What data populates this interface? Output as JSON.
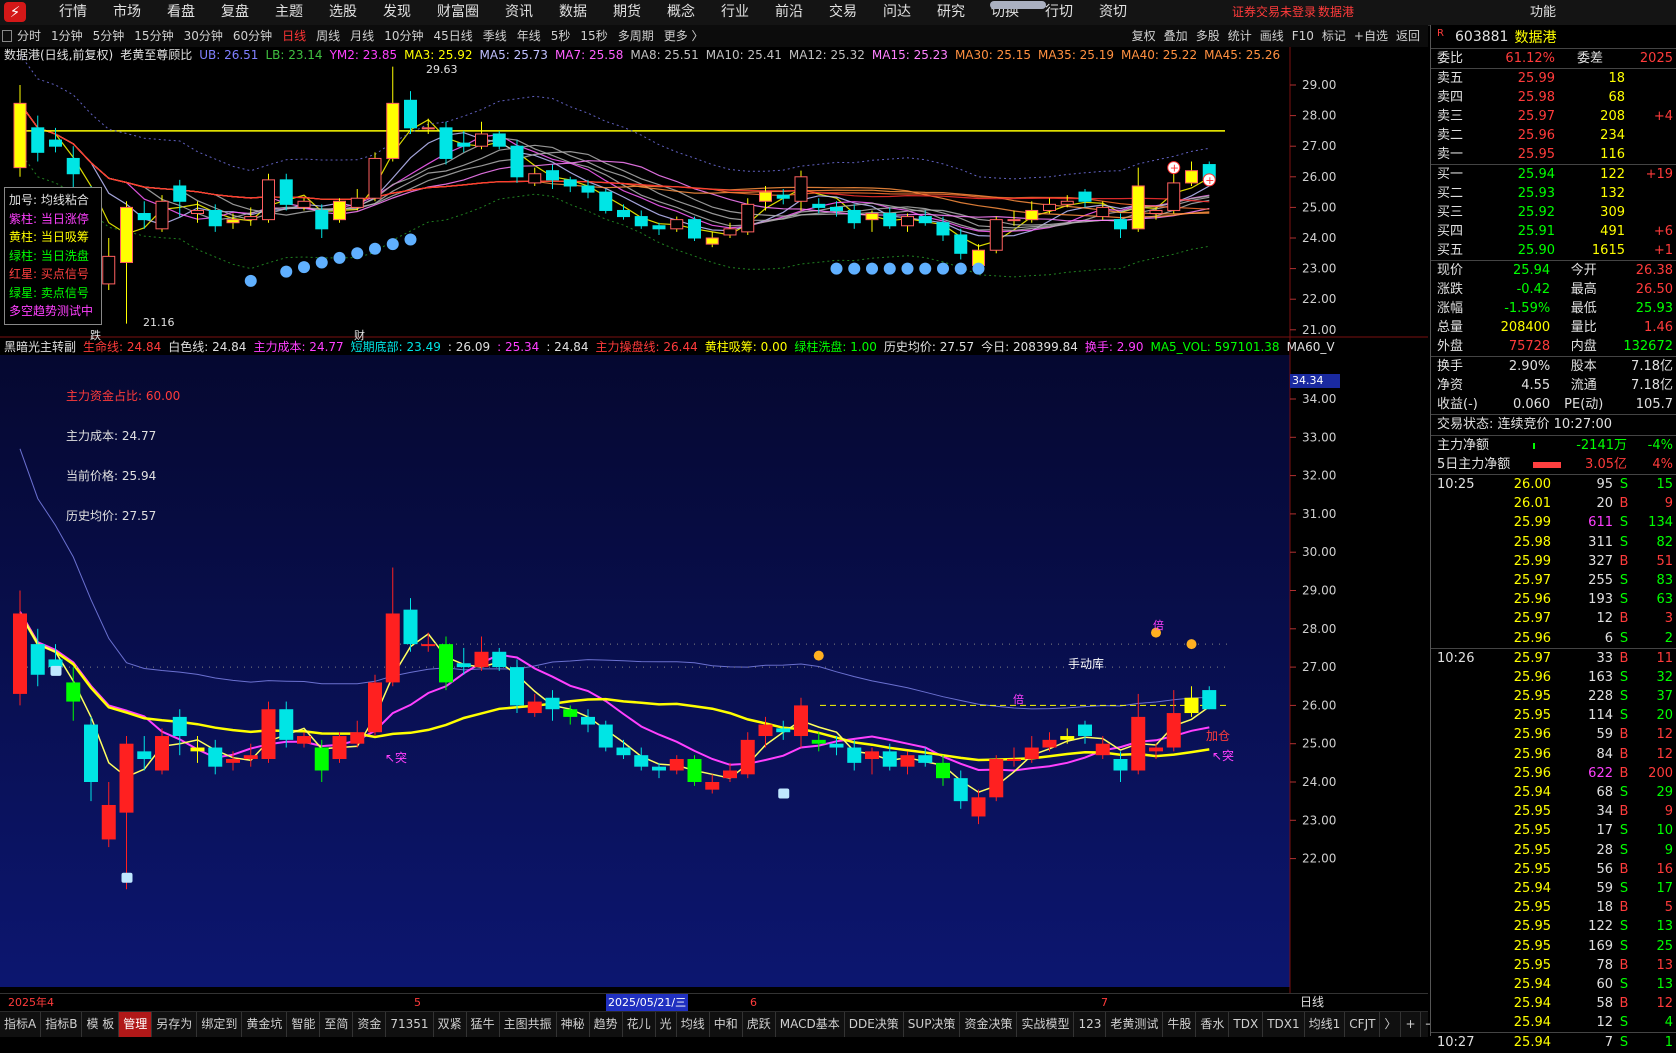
{
  "menu": [
    "行情",
    "市场",
    "看盘",
    "复盘",
    "主题",
    "选股",
    "发现",
    "财富圈",
    "资讯",
    "数据",
    "期货",
    "概念",
    "行业",
    "前沿",
    "交易",
    "问达",
    "研究",
    "切换",
    "行切",
    "资切"
  ],
  "menu_warning": "证券交易未登录",
  "menu_warning2": "数据港",
  "menu_right": "功能",
  "periods": [
    "分时",
    "1分钟",
    "5分钟",
    "15分钟",
    "30分钟",
    "60分钟",
    "日线",
    "周线",
    "月线",
    "10分钟",
    "45日线",
    "季线",
    "年线",
    "5秒",
    "15秒",
    "多周期",
    "更多 〉"
  ],
  "active_period": "日线",
  "tools": [
    "复权",
    "叠加",
    "多股",
    "统计",
    "画线",
    "F10",
    "标记",
    "+自选",
    "返回"
  ],
  "main_legend": {
    "name": "数据港(日线,前复权)",
    "indicator": "老黄至尊顾比",
    "items": [
      {
        "t": "UB: 26.51",
        "c": "#8080ff"
      },
      {
        "t": "LB: 23.14",
        "c": "#40c040"
      },
      {
        "t": "YM2: 23.85",
        "c": "#ff40ff"
      },
      {
        "t": "MA3: 25.92",
        "c": "#ffff00"
      },
      {
        "t": "MA5: 25.73",
        "c": "#c0c0ff"
      },
      {
        "t": "MA7: 25.58",
        "c": "#ff60ff"
      },
      {
        "t": "MA8: 25.51",
        "c": "#c0c0c0"
      },
      {
        "t": "MA10: 25.41",
        "c": "#c0c0c0"
      },
      {
        "t": "MA12: 25.32",
        "c": "#c0c0c0"
      },
      {
        "t": "MA15: 25.23",
        "c": "#ff80ff"
      },
      {
        "t": "MA30: 25.15",
        "c": "#ff9040"
      },
      {
        "t": "MA35: 25.19",
        "c": "#ff9040"
      },
      {
        "t": "MA40: 25.22",
        "c": "#ff9040"
      },
      {
        "t": "MA45: 25.26",
        "c": "#ff9040"
      }
    ]
  },
  "signal_box": [
    {
      "t": "加号: 均线粘合",
      "c": "#e0e0e0"
    },
    {
      "t": "紫柱: 当日涨停",
      "c": "#ff40ff"
    },
    {
      "t": "黄柱: 当日吸筹",
      "c": "#ffff00"
    },
    {
      "t": "绿柱: 当日洗盘",
      "c": "#00ff00"
    },
    {
      "t": "红星: 买点信号",
      "c": "#ff4040"
    },
    {
      "t": "绿星: 卖点信号",
      "c": "#00ff00"
    },
    {
      "t": "多空趋势测试中",
      "c": "#ff40ff"
    }
  ],
  "price_axis_top": [
    "29.00",
    "28.00",
    "27.00",
    "26.00",
    "25.00",
    "24.00",
    "23.00",
    "22.00",
    "21.00"
  ],
  "price_axis_bottom": [
    "34.00",
    "33.00",
    "32.00",
    "31.00",
    "30.00",
    "29.00",
    "28.00",
    "27.00",
    "26.00",
    "25.00",
    "24.00",
    "23.00",
    "22.00"
  ],
  "axis_highlight": "34.34",
  "top_labels": {
    "high": "29.63",
    "low": "21.16",
    "mark1": "跌",
    "mark2": "财"
  },
  "sub_legend": {
    "name": "黑暗光主转副",
    "items": [
      {
        "t": "生命线: 24.84",
        "c": "#ff3b3b"
      },
      {
        "t": "白色线: 24.84",
        "c": "#e0e0e0"
      },
      {
        "t": "主力成本: 24.77",
        "c": "#ff40ff"
      },
      {
        "t": "短期底部: 23.49",
        "c": "#00e5e5"
      },
      {
        "t": ": 26.09",
        "c": "#e0e0e0"
      },
      {
        "t": ": 25.34",
        "c": "#ff40ff"
      },
      {
        "t": ": 24.84",
        "c": "#e0e0e0"
      },
      {
        "t": "主力操盘线: 26.44",
        "c": "#ff3b3b"
      },
      {
        "t": "黄柱吸筹: 0.00",
        "c": "#ffff00"
      },
      {
        "t": "绿柱洗盘: 1.00",
        "c": "#00ff00"
      },
      {
        "t": "历史均价: 27.57",
        "c": "#e0e0e0"
      },
      {
        "t": "今日: 208399.84",
        "c": "#e0e0e0"
      },
      {
        "t": "换手: 2.90",
        "c": "#ff40ff"
      },
      {
        "t": "MA5_VOL: 597101.38",
        "c": "#00ff00"
      },
      {
        "t": "MA60_V",
        "c": "#e0e0e0"
      }
    ]
  },
  "sub_notes": [
    {
      "t": "主力资金占比:   60.00",
      "c": "#ff3b3b"
    },
    {
      "t": "主力成本: 24.77",
      "c": "#e0e0e0"
    },
    {
      "t": "当前价格: 25.94",
      "c": "#e0e0e0"
    },
    {
      "t": "历史均价: 27.57",
      "c": "#e0e0e0"
    }
  ],
  "sub_marks": {
    "tu1": "↖突",
    "tu2": "↖突",
    "shou": "手动库",
    "jia": "加仓",
    "bei": "倍",
    "bei2": "倍"
  },
  "dates": [
    "2025年4",
    "5",
    "2025/05/21/三",
    "6",
    "7"
  ],
  "date_right": "日线",
  "bottom_tabs": [
    "指标A",
    "指标B",
    "模 板",
    "管理",
    "另存为",
    "绑定到",
    "黄金坑",
    "智能",
    "至简",
    "资金",
    "71351",
    "双紧",
    "猛牛",
    "主图共振",
    "神秘",
    "趋势",
    "花儿",
    "光",
    "均线",
    "中和",
    "虎跃",
    "MACD基本",
    "DDE决策",
    "SUP决策",
    "资金决策",
    "实战模型",
    "123",
    "老黄测试",
    "牛股",
    "香水",
    "TDX",
    "TDX1",
    "均线1",
    "CFJT",
    "〉",
    "+",
    "−"
  ],
  "bottom_active": "管理",
  "stock": {
    "code": "603881",
    "name": "数据港",
    "badge": "R"
  },
  "weibi": {
    "label": "委比",
    "value": "61.12%",
    "label2": "委差",
    "value2": "2025"
  },
  "sell": [
    {
      "l": "卖五",
      "p": "25.99",
      "v": "18",
      "d": ""
    },
    {
      "l": "卖四",
      "p": "25.98",
      "v": "68",
      "d": ""
    },
    {
      "l": "卖三",
      "p": "25.97",
      "v": "208",
      "d": "+4"
    },
    {
      "l": "卖二",
      "p": "25.96",
      "v": "234",
      "d": ""
    },
    {
      "l": "卖一",
      "p": "25.95",
      "v": "116",
      "d": ""
    }
  ],
  "buy": [
    {
      "l": "买一",
      "p": "25.94",
      "v": "122",
      "d": "+19"
    },
    {
      "l": "买二",
      "p": "25.93",
      "v": "132",
      "d": ""
    },
    {
      "l": "买三",
      "p": "25.92",
      "v": "309",
      "d": ""
    },
    {
      "l": "买四",
      "p": "25.91",
      "v": "491",
      "d": "+6"
    },
    {
      "l": "买五",
      "p": "25.90",
      "v": "1615",
      "d": "+1"
    }
  ],
  "quote": [
    {
      "a": "现价",
      "b": "25.94",
      "bc": "dn",
      "c": "今开",
      "d": "26.38",
      "dc": "up"
    },
    {
      "a": "涨跌",
      "b": "-0.42",
      "bc": "dn",
      "c": "最高",
      "d": "26.50",
      "dc": "up"
    },
    {
      "a": "涨幅",
      "b": "-1.59%",
      "bc": "dn",
      "c": "最低",
      "d": "25.93",
      "dc": "dn"
    },
    {
      "a": "总量",
      "b": "208400",
      "bc": "yl",
      "c": "量比",
      "d": "1.46",
      "dc": "up"
    },
    {
      "a": "外盘",
      "b": "75728",
      "bc": "up",
      "c": "内盘",
      "d": "132672",
      "dc": "dn"
    }
  ],
  "quote2": [
    {
      "a": "换手",
      "b": "2.90%",
      "c": "股本",
      "d": "7.18亿"
    },
    {
      "a": "净资",
      "b": "4.55",
      "c": "流通",
      "d": "7.18亿"
    },
    {
      "a": "收益(-)",
      "b": "0.060",
      "c": "PE(动)",
      "d": "105.7"
    }
  ],
  "trade_state": "交易状态: 连续竞价 10:27:00",
  "flow": [
    {
      "a": "主力净额",
      "b": "-2141万",
      "c": "-4%"
    },
    {
      "a": "5日主力净额",
      "b": "3.05亿",
      "c": "4%"
    }
  ],
  "ticks": [
    {
      "t": "10:25",
      "p": "26.00",
      "pc": "yl",
      "v": "95",
      "vc": "wh",
      "s": "S",
      "n": "15"
    },
    {
      "t": "",
      "p": "26.01",
      "pc": "yl",
      "v": "20",
      "vc": "wh",
      "s": "B",
      "n": "9"
    },
    {
      "t": "",
      "p": "25.99",
      "pc": "yl",
      "v": "611",
      "vc": "mg",
      "s": "S",
      "n": "134"
    },
    {
      "t": "",
      "p": "25.98",
      "pc": "yl",
      "v": "311",
      "vc": "wh",
      "s": "S",
      "n": "82"
    },
    {
      "t": "",
      "p": "25.99",
      "pc": "yl",
      "v": "327",
      "vc": "wh",
      "s": "B",
      "n": "51"
    },
    {
      "t": "",
      "p": "25.97",
      "pc": "yl",
      "v": "255",
      "vc": "wh",
      "s": "S",
      "n": "83"
    },
    {
      "t": "",
      "p": "25.96",
      "pc": "yl",
      "v": "193",
      "vc": "wh",
      "s": "S",
      "n": "63"
    },
    {
      "t": "",
      "p": "25.97",
      "pc": "yl",
      "v": "12",
      "vc": "wh",
      "s": "B",
      "n": "3"
    },
    {
      "t": "",
      "p": "25.96",
      "pc": "yl",
      "v": "6",
      "vc": "wh",
      "s": "S",
      "n": "2"
    },
    {
      "t": "10:26",
      "p": "25.97",
      "pc": "yl",
      "v": "33",
      "vc": "wh",
      "s": "B",
      "n": "11"
    },
    {
      "t": "",
      "p": "25.96",
      "pc": "yl",
      "v": "163",
      "vc": "wh",
      "s": "S",
      "n": "32"
    },
    {
      "t": "",
      "p": "25.95",
      "pc": "yl",
      "v": "228",
      "vc": "wh",
      "s": "S",
      "n": "37"
    },
    {
      "t": "",
      "p": "25.95",
      "pc": "yl",
      "v": "114",
      "vc": "wh",
      "s": "S",
      "n": "20"
    },
    {
      "t": "",
      "p": "25.96",
      "pc": "yl",
      "v": "59",
      "vc": "wh",
      "s": "B",
      "n": "12"
    },
    {
      "t": "",
      "p": "25.96",
      "pc": "yl",
      "v": "84",
      "vc": "wh",
      "s": "B",
      "n": "12"
    },
    {
      "t": "",
      "p": "25.96",
      "pc": "yl",
      "v": "622",
      "vc": "mg",
      "s": "B",
      "n": "200"
    },
    {
      "t": "",
      "p": "25.94",
      "pc": "yl",
      "v": "68",
      "vc": "wh",
      "s": "S",
      "n": "29"
    },
    {
      "t": "",
      "p": "25.95",
      "pc": "yl",
      "v": "34",
      "vc": "wh",
      "s": "B",
      "n": "9"
    },
    {
      "t": "",
      "p": "25.95",
      "pc": "yl",
      "v": "17",
      "vc": "wh",
      "s": "S",
      "n": "10"
    },
    {
      "t": "",
      "p": "25.95",
      "pc": "yl",
      "v": "28",
      "vc": "wh",
      "s": "S",
      "n": "9"
    },
    {
      "t": "",
      "p": "25.95",
      "pc": "yl",
      "v": "56",
      "vc": "wh",
      "s": "B",
      "n": "16"
    },
    {
      "t": "",
      "p": "25.94",
      "pc": "yl",
      "v": "59",
      "vc": "wh",
      "s": "S",
      "n": "17"
    },
    {
      "t": "",
      "p": "25.95",
      "pc": "yl",
      "v": "18",
      "vc": "wh",
      "s": "B",
      "n": "5"
    },
    {
      "t": "",
      "p": "25.95",
      "pc": "yl",
      "v": "122",
      "vc": "wh",
      "s": "S",
      "n": "13"
    },
    {
      "t": "",
      "p": "25.95",
      "pc": "yl",
      "v": "169",
      "vc": "wh",
      "s": "S",
      "n": "25"
    },
    {
      "t": "",
      "p": "25.95",
      "pc": "yl",
      "v": "78",
      "vc": "wh",
      "s": "B",
      "n": "13"
    },
    {
      "t": "",
      "p": "25.94",
      "pc": "yl",
      "v": "60",
      "vc": "wh",
      "s": "S",
      "n": "13"
    },
    {
      "t": "",
      "p": "25.94",
      "pc": "yl",
      "v": "58",
      "vc": "wh",
      "s": "B",
      "n": "12"
    },
    {
      "t": "",
      "p": "25.94",
      "pc": "yl",
      "v": "12",
      "vc": "wh",
      "s": "S",
      "n": "4"
    },
    {
      "t": "10:27",
      "p": "25.94",
      "pc": "yl",
      "v": "7",
      "vc": "wh",
      "s": "S",
      "n": "1"
    }
  ],
  "candles": [
    {
      "o": 26.3,
      "c": 28.4,
      "h": 29.0,
      "l": 26.0
    },
    {
      "o": 27.6,
      "c": 26.8,
      "h": 28.0,
      "l": 26.5
    },
    {
      "o": 27.2,
      "c": 27.0,
      "h": 27.6,
      "l": 26.8
    },
    {
      "o": 26.6,
      "c": 26.1,
      "h": 27.0,
      "l": 25.6
    },
    {
      "o": 25.5,
      "c": 24.0,
      "h": 25.7,
      "l": 23.5
    },
    {
      "o": 22.5,
      "c": 23.4,
      "h": 24.0,
      "l": 22.3
    },
    {
      "o": 23.2,
      "c": 25.0,
      "h": 25.2,
      "l": 21.2
    },
    {
      "o": 24.8,
      "c": 24.6,
      "h": 25.2,
      "l": 24.3
    },
    {
      "o": 24.3,
      "c": 25.2,
      "h": 25.4,
      "l": 24.2
    },
    {
      "o": 25.7,
      "c": 25.2,
      "h": 25.9,
      "l": 24.7
    },
    {
      "o": 24.8,
      "c": 24.9,
      "h": 25.2,
      "l": 24.5
    },
    {
      "o": 24.9,
      "c": 24.4,
      "h": 25.1,
      "l": 24.2
    },
    {
      "o": 24.5,
      "c": 24.6,
      "h": 24.8,
      "l": 24.3
    },
    {
      "o": 24.6,
      "c": 24.7,
      "h": 25.0,
      "l": 24.4
    },
    {
      "o": 24.6,
      "c": 25.9,
      "h": 26.1,
      "l": 24.5
    },
    {
      "o": 25.9,
      "c": 25.1,
      "h": 26.1,
      "l": 24.9
    },
    {
      "o": 25.0,
      "c": 25.2,
      "h": 25.3,
      "l": 24.9
    },
    {
      "o": 24.9,
      "c": 24.3,
      "h": 25.1,
      "l": 24.0
    },
    {
      "o": 24.6,
      "c": 25.2,
      "h": 25.3,
      "l": 24.5
    },
    {
      "o": 25.0,
      "c": 25.3,
      "h": 25.6,
      "l": 24.9
    },
    {
      "o": 25.3,
      "c": 26.6,
      "h": 26.8,
      "l": 25.2
    },
    {
      "o": 26.6,
      "c": 28.4,
      "h": 29.6,
      "l": 26.5
    },
    {
      "o": 28.5,
      "c": 27.6,
      "h": 28.8,
      "l": 27.4
    },
    {
      "o": 27.6,
      "c": 27.6,
      "h": 27.9,
      "l": 27.4
    },
    {
      "o": 27.6,
      "c": 26.6,
      "h": 27.8,
      "l": 26.4
    },
    {
      "o": 27.1,
      "c": 27.0,
      "h": 27.5,
      "l": 26.8
    },
    {
      "o": 27.0,
      "c": 27.4,
      "h": 27.8,
      "l": 26.9
    },
    {
      "o": 27.4,
      "c": 27.0,
      "h": 27.5,
      "l": 26.9
    },
    {
      "o": 27.0,
      "c": 26.0,
      "h": 27.2,
      "l": 25.8
    },
    {
      "o": 25.8,
      "c": 26.1,
      "h": 26.3,
      "l": 25.7
    },
    {
      "o": 26.2,
      "c": 25.9,
      "h": 26.4,
      "l": 25.6
    },
    {
      "o": 25.9,
      "c": 25.7,
      "h": 26.0,
      "l": 25.5
    },
    {
      "o": 25.7,
      "c": 25.5,
      "h": 25.9,
      "l": 25.3
    },
    {
      "o": 25.5,
      "c": 24.9,
      "h": 25.6,
      "l": 24.8
    },
    {
      "o": 24.9,
      "c": 24.7,
      "h": 25.1,
      "l": 24.6
    },
    {
      "o": 24.7,
      "c": 24.4,
      "h": 24.9,
      "l": 24.3
    },
    {
      "o": 24.4,
      "c": 24.3,
      "h": 24.5,
      "l": 24.1
    },
    {
      "o": 24.3,
      "c": 24.6,
      "h": 24.7,
      "l": 24.2
    },
    {
      "o": 24.6,
      "c": 24.0,
      "h": 24.7,
      "l": 23.9
    },
    {
      "o": 23.8,
      "c": 24.0,
      "h": 24.2,
      "l": 23.7
    },
    {
      "o": 24.1,
      "c": 24.3,
      "h": 24.5,
      "l": 24.0
    },
    {
      "o": 24.2,
      "c": 25.1,
      "h": 25.3,
      "l": 24.1
    },
    {
      "o": 25.2,
      "c": 25.5,
      "h": 25.7,
      "l": 24.9
    },
    {
      "o": 25.4,
      "c": 25.3,
      "h": 25.6,
      "l": 25.1
    },
    {
      "o": 25.2,
      "c": 26.0,
      "h": 26.2,
      "l": 24.9
    },
    {
      "o": 25.1,
      "c": 25.0,
      "h": 25.3,
      "l": 24.8
    },
    {
      "o": 25.0,
      "c": 24.9,
      "h": 25.2,
      "l": 24.7
    },
    {
      "o": 24.9,
      "c": 24.5,
      "h": 25.1,
      "l": 24.3
    },
    {
      "o": 24.6,
      "c": 24.8,
      "h": 24.9,
      "l": 24.2
    },
    {
      "o": 24.8,
      "c": 24.4,
      "h": 25.0,
      "l": 24.3
    },
    {
      "o": 24.4,
      "c": 24.7,
      "h": 24.8,
      "l": 24.2
    },
    {
      "o": 24.7,
      "c": 24.5,
      "h": 24.9,
      "l": 24.4
    },
    {
      "o": 24.5,
      "c": 24.1,
      "h": 24.7,
      "l": 23.9
    },
    {
      "o": 24.1,
      "c": 23.5,
      "h": 24.3,
      "l": 23.3
    },
    {
      "o": 23.1,
      "c": 23.6,
      "h": 23.8,
      "l": 22.9
    },
    {
      "o": 23.6,
      "c": 24.6,
      "h": 24.7,
      "l": 23.5
    },
    {
      "o": 24.6,
      "c": 24.6,
      "h": 24.9,
      "l": 24.4
    },
    {
      "o": 24.6,
      "c": 24.9,
      "h": 25.2,
      "l": 24.5
    },
    {
      "o": 24.9,
      "c": 25.1,
      "h": 25.3,
      "l": 24.8
    },
    {
      "o": 25.1,
      "c": 25.2,
      "h": 25.4,
      "l": 25.0
    },
    {
      "o": 25.5,
      "c": 25.2,
      "h": 25.6,
      "l": 25.0
    },
    {
      "o": 24.7,
      "c": 25.0,
      "h": 25.2,
      "l": 24.6
    },
    {
      "o": 24.6,
      "c": 24.3,
      "h": 24.8,
      "l": 24.0
    },
    {
      "o": 24.3,
      "c": 25.7,
      "h": 26.3,
      "l": 24.2
    },
    {
      "o": 24.8,
      "c": 24.9,
      "h": 25.0,
      "l": 24.6
    },
    {
      "o": 24.9,
      "c": 25.8,
      "h": 26.4,
      "l": 24.8
    },
    {
      "o": 25.8,
      "c": 26.2,
      "h": 26.5,
      "l": 25.7
    },
    {
      "o": 26.4,
      "c": 25.9,
      "h": 26.5,
      "l": 25.9
    }
  ]
}
